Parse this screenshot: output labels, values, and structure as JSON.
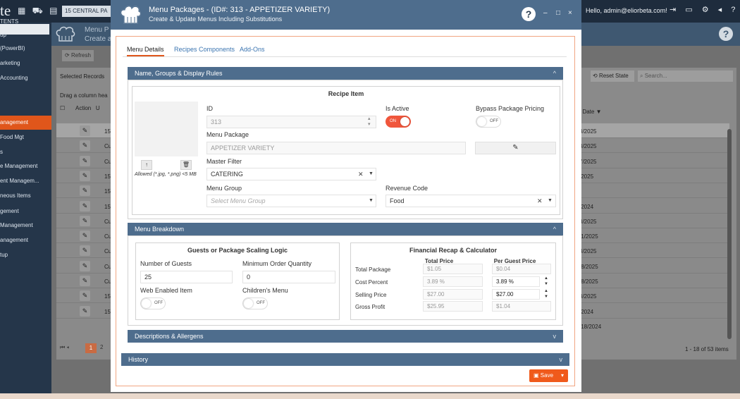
{
  "app": {
    "logo_partial": "te",
    "location": "15 CENTRAL PA",
    "greeting": "Hello, admin@eliorbeta.com!",
    "bg_title_line1": "Menu P",
    "bg_title_line2": "Create a",
    "help": "?"
  },
  "sidebar": {
    "items": [
      "TENTS",
      "up",
      "(PowerBI)",
      "arketing",
      "Accounting",
      "anagement",
      "Food Mgt",
      "s",
      "e Management",
      "ent Managem...",
      "neous Items",
      "gement",
      "Management",
      "anagement",
      "tup"
    ]
  },
  "grid": {
    "refresh": "Refresh",
    "selected_records": "Selected Records",
    "drag_hint": "Drag a column hea",
    "col_action": "Action",
    "col_u": "U",
    "reset_state": "Reset State",
    "search_placeholder": "Search...",
    "date_header": "t Date",
    "row_ids": [
      "15",
      "Cu",
      "Cu",
      "15",
      "15",
      "15",
      "Cu",
      "Cu",
      "Cu",
      "Cu",
      "Cu",
      "15",
      "15"
    ],
    "row_dates": [
      "3/2025",
      "3/2025",
      "7/2025",
      "/2025",
      "",
      "/2024",
      "3/2025",
      "/1/2025",
      "3/2025",
      "/8/2025",
      "/8/2025",
      "3/2025",
      "/2024",
      "/18/2024"
    ],
    "pager_arrows": "⏮ ◂",
    "page_current": "1",
    "page_next": "2",
    "items_count": "1 - 18 of 53 items"
  },
  "modal": {
    "title": "Menu Packages - (ID#: 313 - APPETIZER VARIETY)",
    "subtitle": "Create & Update Menus Including Substitutions",
    "help": "?",
    "minimize": "–",
    "maximize": "□",
    "close": "×",
    "tabs": [
      "Menu Details",
      "Recipes Components",
      "Add-Ons"
    ],
    "sections": {
      "name_groups": "Name, Groups & Display Rules",
      "menu_breakdown": "Menu Breakdown",
      "descriptions": "Descriptions & Allergens",
      "history": "History"
    },
    "recipe_item": {
      "heading": "Recipe Item",
      "upload_icon": "↑",
      "delete_icon": "🗑",
      "allowed": "Allowed (*.jpg, *.png) <5 MB",
      "id_label": "ID",
      "id_value": "313",
      "is_active_label": "Is Active",
      "is_active_state": "ON",
      "bypass_label": "Bypass Package Pricing",
      "bypass_state": "OFF",
      "menu_package_label": "Menu Package",
      "menu_package_value": "APPETIZER VARIETY",
      "master_filter_label": "Master Filter",
      "master_filter_value": "CATERING",
      "menu_group_label": "Menu Group",
      "menu_group_placeholder": "Select Menu Group",
      "revenue_code_label": "Revenue Code",
      "revenue_code_value": "Food"
    },
    "scaling": {
      "heading": "Guests or Package Scaling Logic",
      "guests_label": "Number of Guests",
      "guests_value": "25",
      "min_order_label": "Minimum Order Quantity",
      "min_order_value": "0",
      "web_enabled_label": "Web Enabled Item",
      "web_enabled_state": "OFF",
      "childrens_label": "Children's Menu",
      "childrens_state": "OFF"
    },
    "financial": {
      "heading": "Financial Recap & Calculator",
      "col_total": "Total Price",
      "col_per_guest": "Per Guest Price",
      "rows": [
        {
          "label": "Total Package",
          "total": "$1.05",
          "per_guest": "$0.04"
        },
        {
          "label": "Cost Percent",
          "total": "3.89 %",
          "per_guest": "3.89 %"
        },
        {
          "label": "Selling Price",
          "total": "$27.00",
          "per_guest": "$27.00"
        },
        {
          "label": "Gross Profit",
          "total": "$25.95",
          "per_guest": "$1.04"
        }
      ]
    },
    "save": "Save"
  },
  "colors": {
    "modal_header": "#4e6d8d",
    "accent": "#e0561b",
    "toggle_on": "#f0563c",
    "topbar": "#1e2c3d"
  }
}
